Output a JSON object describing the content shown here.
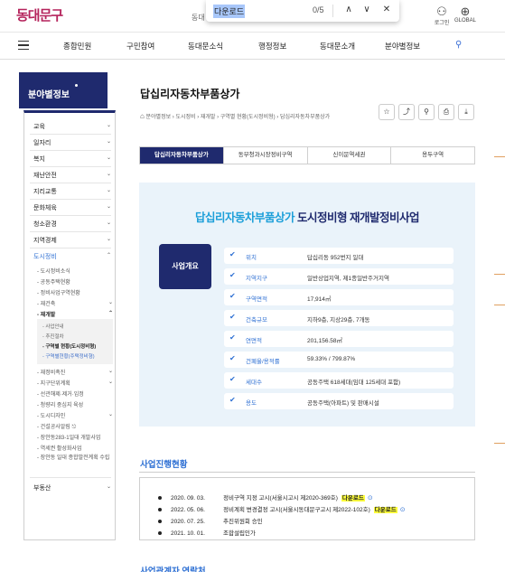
{
  "header": {
    "logo": "동대문구",
    "logo_sub": "동대",
    "login": "로그인",
    "global": "GLOBAL",
    "icons": {
      "login": "person-icon",
      "global": "globe-icon"
    }
  },
  "findbar": {
    "query": "다운로드",
    "count": "0/5",
    "up": "∧",
    "down": "∨",
    "close": "✕"
  },
  "gnb": {
    "items": [
      "종합민원",
      "구민참여",
      "동대문소식",
      "행정정보",
      "동대문소개",
      "분야별정보"
    ]
  },
  "lnb": {
    "title": "분야별정보",
    "items": [
      {
        "label": "교육",
        "chev": "⌄"
      },
      {
        "label": "일자리",
        "chev": "⌄"
      },
      {
        "label": "복지",
        "chev": "⌄"
      },
      {
        "label": "재난안전",
        "chev": "⌄"
      },
      {
        "label": "지리교통",
        "chev": "⌄"
      },
      {
        "label": "문화체육",
        "chev": "⌄"
      },
      {
        "label": "청소환경",
        "chev": "⌄"
      },
      {
        "label": "지역경제",
        "chev": "⌄"
      },
      {
        "label": "도시정비",
        "chev": "⌃"
      }
    ],
    "subs1": [
      {
        "label": "도시정비소식"
      },
      {
        "label": "공동주택현황"
      },
      {
        "label": "정비사업구역현황"
      },
      {
        "label": "재건축",
        "chev": "⌄"
      },
      {
        "label": "재개발",
        "chev": "⌃"
      }
    ],
    "subs2": [
      "사업안내",
      "추진절차",
      "구역별 현황(도시정비형)",
      "구역별현황(주택정비형)"
    ],
    "subs3": [
      {
        "label": "재정비촉진",
        "chev": "⌄"
      },
      {
        "label": "지구단위계획",
        "chev": "⌄"
      },
      {
        "label": "선관해제·제거·임정"
      },
      {
        "label": "청량리 중심지 육성"
      },
      {
        "label": "도시디자인",
        "chev": "⌄"
      },
      {
        "label": "건설공사알림 ⎋"
      },
      {
        "label": "장안동283-1일대 개발사업"
      },
      {
        "label": "역세권 활성화사업"
      },
      {
        "label": "장안동 일대 종합발전계획 수립"
      }
    ],
    "last": {
      "label": "부동산",
      "chev": "⌄"
    }
  },
  "content": {
    "title": "답십리자동차부품상가",
    "breadcrumb": "분야별정보 › 도시정비 › 재개발 › 구역별 현황(도시정비형) › 답십리자동차부품상가",
    "tools": [
      "☆",
      "⤴",
      "⚲",
      "⎙",
      "⤓"
    ],
    "tabs": [
      "답십리자동차부품상가",
      "동부청과시장정비구역",
      "신이문역세권",
      "용두구역"
    ],
    "active_tab": 0
  },
  "info": {
    "title_hl": "답십리자동차부품상가",
    "title_rest": "도시정비형 재개발정비사업",
    "badge": "사업개요",
    "rows": [
      {
        "k": "위치",
        "v": "답십리동 952번지 일대"
      },
      {
        "k": "지역지구",
        "v": "일반상업지역, 제1종일반주거지역"
      },
      {
        "k": "구역면적",
        "v": "17,914㎡"
      },
      {
        "k": "건축규모",
        "v": "지하9층, 지상29층, 7개동"
      },
      {
        "k": "연면적",
        "v": "201,156.58㎡"
      },
      {
        "k": "건폐율/용적률",
        "v": "59.33% / 799.87%"
      },
      {
        "k": "세대수",
        "v": "공동주택 618세대(임대 125세대 포함)"
      },
      {
        "k": "용도",
        "v": "공동주택(아파트) 및 판매시설"
      }
    ]
  },
  "progress": {
    "title": "사업진행현황",
    "rows": [
      {
        "date": "2020. 09. 03.",
        "text": "정비구역 지정 고시(서울시고시 제2020-369호)",
        "dl": "다운로드"
      },
      {
        "date": "2022. 05. 06.",
        "text": "정비계획 변경결정 고시(서울시동대문구고시 제2022-102호)",
        "dl": "다운로드"
      },
      {
        "date": "2020. 07. 25.",
        "text": "추진위원회 승인",
        "dl": ""
      },
      {
        "date": "2021. 10. 01.",
        "text": "조합설립인가",
        "dl": ""
      }
    ],
    "dl_icon": "⊙"
  },
  "next_section": "사업관계자 연락처",
  "colors": {
    "navy": "#1f2a6e",
    "blue": "#2d6fd3",
    "cyan": "#1d9fd9",
    "logo": "#b5245c"
  }
}
